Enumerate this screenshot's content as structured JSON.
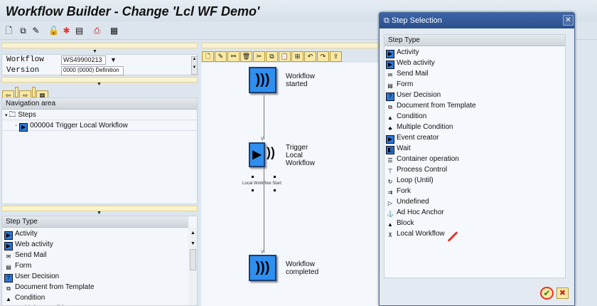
{
  "title": "Workflow Builder - Change 'Lcl WF Demo'",
  "toolbar_icons": [
    "new-icon",
    "copy-icon",
    "edit-icon",
    "unlock-icon",
    "spark-icon",
    "display-icon",
    "print-icon",
    "layout-icon"
  ],
  "form": {
    "workflow_label": "Workflow",
    "workflow_value": "WS49900213",
    "version_label": "Version",
    "version_value": "0000 (0000) Definition"
  },
  "navigation": {
    "header": "Navigation area",
    "root": "Steps",
    "child": "000004 Trigger Local Workflow"
  },
  "step_types_header": "Step Type",
  "step_types": [
    "Activity",
    "Web activity",
    "Send Mail",
    "Form",
    "User Decision",
    "Document from Template",
    "Condition",
    "Multiple Condition",
    "Event creator",
    "Wait",
    "Container operation",
    "Process Control",
    "Loop (Until)",
    "Fork",
    "Undefined",
    "Ad Hoc Anchor",
    "Block",
    "Local Workflow"
  ],
  "graph": {
    "start": "Workflow started",
    "trigger": "Trigger Local Workflow",
    "outcome": "Local Workflow Start",
    "end": "Workflow completed"
  },
  "dialog": {
    "title": "Step Selection",
    "header": "Step Type",
    "confirm": "✔",
    "cancel": "✖",
    "close": "✕"
  },
  "colors": {
    "node": "#2f8ff0",
    "dialog_title": "#2b4f8c",
    "annotation": "#e8322a"
  }
}
